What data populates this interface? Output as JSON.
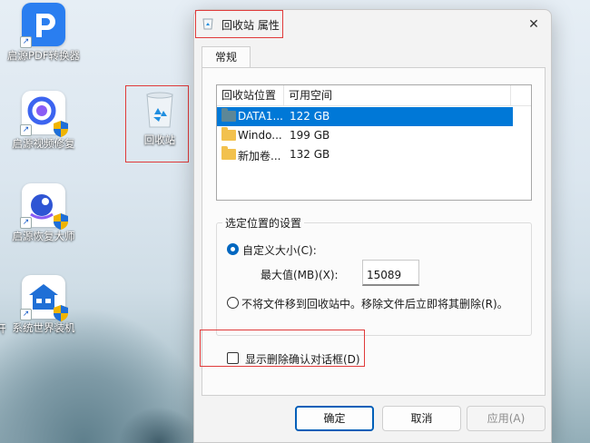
{
  "desktop": {
    "icons": [
      {
        "label": "启源PDF转换器",
        "color": "#2a7ef0"
      },
      {
        "label": "启源视频修复",
        "color": "#ffffff"
      },
      {
        "label": "启源恢复大师",
        "color": "#ffffff"
      },
      {
        "label": "系统世界装机",
        "color": "#ffffff"
      },
      {
        "label": "回收站"
      }
    ],
    "left_cut_label": "开"
  },
  "dialog": {
    "title": "回收站 属性",
    "close_glyph": "✕",
    "tab_label": "常规",
    "list": {
      "col1": "回收站位置",
      "col2": "可用空间",
      "rows": [
        {
          "name": "DATA1...",
          "space": "122 GB",
          "selected": true
        },
        {
          "name": "Windo...",
          "space": "199 GB",
          "selected": false
        },
        {
          "name": "新加卷...",
          "space": "132 GB",
          "selected": false
        }
      ]
    },
    "settings": {
      "group_title": "选定位置的设置",
      "custom_size_label": "自定义大小(C):",
      "max_label": "最大值(MB)(X):",
      "max_value": "15089",
      "no_move_label": "不将文件移到回收站中。移除文件后立即将其删除(R)。"
    },
    "confirm_checkbox_label": "显示删除确认对话框(D)",
    "buttons": {
      "ok": "确定",
      "cancel": "取消",
      "apply": "应用(A)"
    }
  },
  "colors": {
    "accent": "#0078d7",
    "highlight_frame": "#e03a3a"
  }
}
